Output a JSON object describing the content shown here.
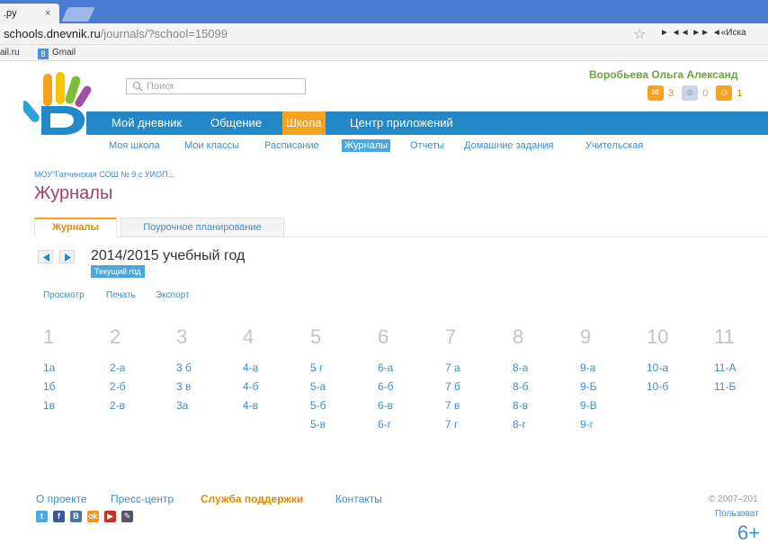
{
  "browser": {
    "tab_title": ".py",
    "tab_close": "×",
    "url_domain": "schools.dnevnik.ru",
    "url_path": "/journals/?school=15099",
    "media_controls": "► ◄◄ ►► ◄«Иска",
    "bookmarks": [
      {
        "label": "ail.ru"
      },
      {
        "label": "Gmail",
        "icon": "gmail-icon"
      }
    ]
  },
  "header": {
    "search_placeholder": "Поиск",
    "username": "Воробьева Ольга Александ",
    "counters": [
      {
        "icon": "mail-icon",
        "value": "3",
        "color": "#f7a21c"
      },
      {
        "icon": "person-icon",
        "value": "0",
        "color": "#c8d8e8"
      },
      {
        "icon": "people-icon",
        "value": "1",
        "color": "#f7a21c"
      }
    ],
    "colors": {
      "accent_blue": "#2288c8",
      "accent_orange": "#f7a21c",
      "title_purple": "#a04070",
      "user_green": "#6aa63a"
    }
  },
  "mainnav": [
    {
      "label": "Мой дневник",
      "active": false
    },
    {
      "label": "Общение",
      "active": false
    },
    {
      "label": "Школа",
      "active": true
    },
    {
      "label": "Центр приложений",
      "active": false
    }
  ],
  "subnav": [
    {
      "label": "Моя школа",
      "active": false
    },
    {
      "label": "Мои классы",
      "active": false
    },
    {
      "label": "Расписание",
      "active": false
    },
    {
      "label": "Журналы",
      "active": true
    },
    {
      "label": "Отчеты",
      "active": false
    },
    {
      "label": "Домашние задания",
      "active": false
    },
    {
      "label": "Учительская",
      "active": false
    }
  ],
  "breadcrumb": "МОУ\"Гатчинская СОШ № 9 с УИОП...",
  "page_title": "Журналы",
  "tabs": [
    {
      "label": "Журналы",
      "active": true
    },
    {
      "label": "Поурочное планирование",
      "active": false
    }
  ],
  "year": {
    "title": "2014/2015 учебный год",
    "current_label": "Текущий год"
  },
  "actions": [
    "Просмотр",
    "Печать",
    "Экспорт"
  ],
  "grades": [
    {
      "number": "1",
      "classes": [
        "1а",
        "1б",
        "1в"
      ]
    },
    {
      "number": "2",
      "classes": [
        "2-а",
        "2-б",
        "2-в"
      ]
    },
    {
      "number": "3",
      "classes": [
        "3 б",
        "3 в",
        "3а"
      ]
    },
    {
      "number": "4",
      "classes": [
        "4-а",
        "4-б",
        "4-в"
      ]
    },
    {
      "number": "5",
      "classes": [
        "5 г",
        "5-а",
        "5-б",
        "5-в"
      ]
    },
    {
      "number": "6",
      "classes": [
        "6-а",
        "6-б",
        "6-в",
        "6-г"
      ]
    },
    {
      "number": "7",
      "classes": [
        "7 а",
        "7 б",
        "7 в",
        "7 г"
      ]
    },
    {
      "number": "8",
      "classes": [
        "8-а",
        "8-б",
        "8-в",
        "8-г"
      ]
    },
    {
      "number": "9",
      "classes": [
        "9-а",
        "9-Б",
        "9-В",
        "9-г"
      ]
    },
    {
      "number": "10",
      "classes": [
        "10-а",
        "10-б"
      ]
    },
    {
      "number": "11",
      "classes": [
        "11-А",
        "11-Б"
      ]
    }
  ],
  "footer": {
    "links": [
      {
        "label": "О проекте",
        "support": false
      },
      {
        "label": "Пресс-центр",
        "support": false
      },
      {
        "label": "Служба поддержки",
        "support": true
      },
      {
        "label": "Контакты",
        "support": false
      }
    ],
    "social": [
      {
        "icon": "twitter-icon",
        "glyph": "t",
        "color": "#4aa8dc"
      },
      {
        "icon": "facebook-icon",
        "glyph": "f",
        "color": "#3b5998"
      },
      {
        "icon": "vkontakte-icon",
        "glyph": "B",
        "color": "#4c75a3"
      },
      {
        "icon": "odnoklassniki-icon",
        "glyph": "ok",
        "color": "#f7931e"
      },
      {
        "icon": "youtube-icon",
        "glyph": "▶",
        "color": "#c4302b"
      },
      {
        "icon": "pen-icon",
        "glyph": "✎",
        "color": "#556"
      }
    ],
    "copyright": "© 2007–201",
    "user_link": "Пользоват",
    "age_rating": "6+"
  }
}
